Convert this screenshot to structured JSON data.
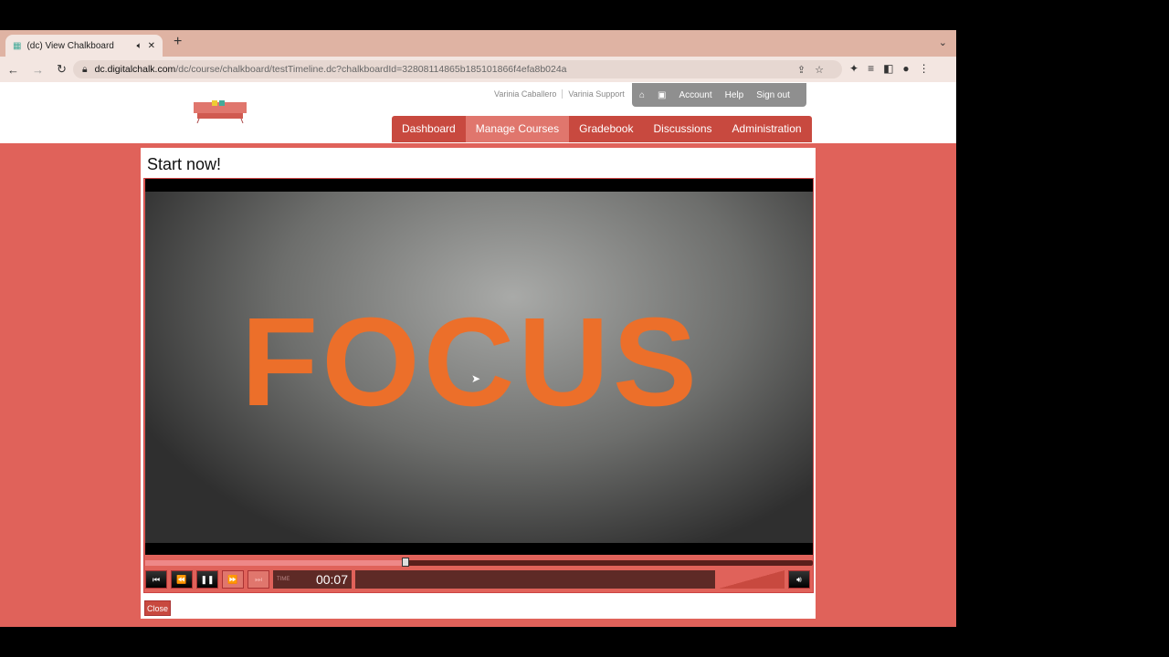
{
  "browser": {
    "tab_title": "(dc) View Chalkboard",
    "url_host": "dc.digitalchalk.com",
    "url_path": "/dc/course/chalkboard/testTimeline.dc?chalkboardId=32808114865b185101866f4efa8b024a"
  },
  "header": {
    "user_name": "Varinia Caballero",
    "org": "Varinia Support",
    "top_links": [
      "Account",
      "Help",
      "Sign out"
    ],
    "nav": [
      {
        "label": "Dashboard"
      },
      {
        "label": "Manage Courses",
        "active": true
      },
      {
        "label": "Gradebook"
      },
      {
        "label": "Discussions"
      },
      {
        "label": "Administration"
      }
    ]
  },
  "main": {
    "title": "Start now!",
    "video_text": "FOCUS",
    "player": {
      "time_label": "TIME",
      "time": "00:07",
      "progress_percent": 39,
      "playing": true
    },
    "close_label": "Close"
  },
  "colors": {
    "brand": "#e0625a",
    "nav": "#c8493f"
  }
}
